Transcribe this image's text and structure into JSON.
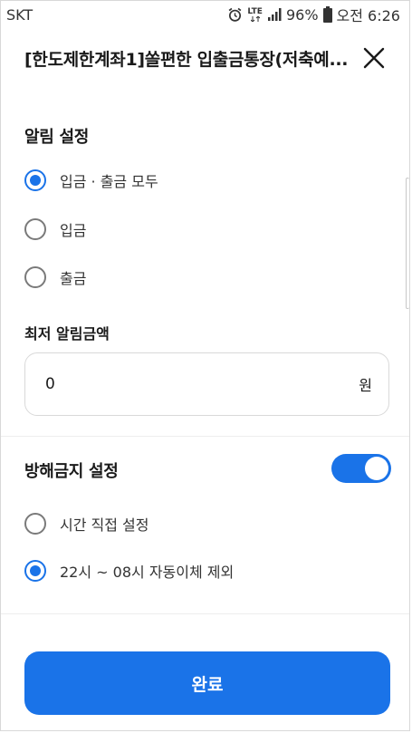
{
  "status_bar": {
    "carrier": "SKT",
    "network": "LTE",
    "battery": "96%",
    "time": "오전 6:26",
    "icons": [
      "alarm-icon",
      "lte-icon",
      "signal-icon",
      "battery-icon"
    ]
  },
  "header": {
    "title": "[한도제한계좌1]쏠편한 입출금통장(저축예...",
    "close_icon": "close-icon"
  },
  "alert_settings": {
    "title": "알림 설정",
    "options": [
      {
        "label": "입금 · 출금 모두",
        "checked": true
      },
      {
        "label": "입금",
        "checked": false
      },
      {
        "label": "출금",
        "checked": false
      }
    ]
  },
  "minimum_amount": {
    "title": "최저 알림금액",
    "value": "0",
    "unit": "원"
  },
  "do_not_disturb": {
    "title": "방해금지 설정",
    "enabled": true,
    "options": [
      {
        "label": "시간 직접 설정",
        "checked": false
      },
      {
        "label": "22시 ~ 08시 자동이체 제외",
        "checked": true
      }
    ]
  },
  "actions": {
    "confirm_label": "완료"
  },
  "colors": {
    "accent": "#1a73e8",
    "border": "#d9d9d9",
    "text": "#1a1a1a"
  }
}
